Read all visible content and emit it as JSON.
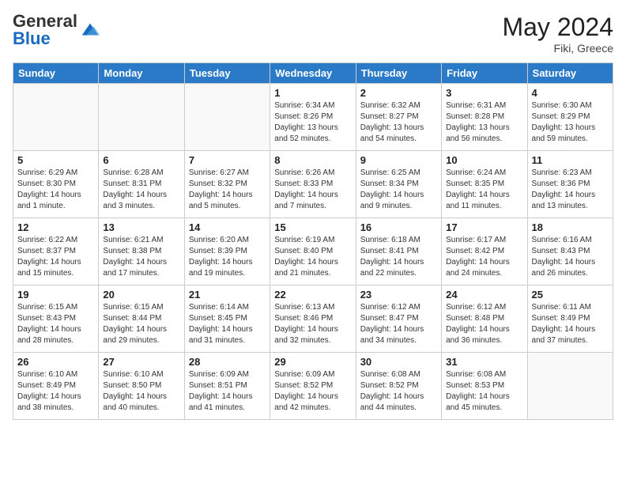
{
  "header": {
    "logo_general": "General",
    "logo_blue": "Blue",
    "month_year": "May 2024",
    "location": "Fiki, Greece"
  },
  "days_of_week": [
    "Sunday",
    "Monday",
    "Tuesday",
    "Wednesday",
    "Thursday",
    "Friday",
    "Saturday"
  ],
  "weeks": [
    [
      {
        "day": "",
        "sunrise": "",
        "sunset": "",
        "daylight": ""
      },
      {
        "day": "",
        "sunrise": "",
        "sunset": "",
        "daylight": ""
      },
      {
        "day": "",
        "sunrise": "",
        "sunset": "",
        "daylight": ""
      },
      {
        "day": "1",
        "sunrise": "Sunrise: 6:34 AM",
        "sunset": "Sunset: 8:26 PM",
        "daylight": "Daylight: 13 hours and 52 minutes."
      },
      {
        "day": "2",
        "sunrise": "Sunrise: 6:32 AM",
        "sunset": "Sunset: 8:27 PM",
        "daylight": "Daylight: 13 hours and 54 minutes."
      },
      {
        "day": "3",
        "sunrise": "Sunrise: 6:31 AM",
        "sunset": "Sunset: 8:28 PM",
        "daylight": "Daylight: 13 hours and 56 minutes."
      },
      {
        "day": "4",
        "sunrise": "Sunrise: 6:30 AM",
        "sunset": "Sunset: 8:29 PM",
        "daylight": "Daylight: 13 hours and 59 minutes."
      }
    ],
    [
      {
        "day": "5",
        "sunrise": "Sunrise: 6:29 AM",
        "sunset": "Sunset: 8:30 PM",
        "daylight": "Daylight: 14 hours and 1 minute."
      },
      {
        "day": "6",
        "sunrise": "Sunrise: 6:28 AM",
        "sunset": "Sunset: 8:31 PM",
        "daylight": "Daylight: 14 hours and 3 minutes."
      },
      {
        "day": "7",
        "sunrise": "Sunrise: 6:27 AM",
        "sunset": "Sunset: 8:32 PM",
        "daylight": "Daylight: 14 hours and 5 minutes."
      },
      {
        "day": "8",
        "sunrise": "Sunrise: 6:26 AM",
        "sunset": "Sunset: 8:33 PM",
        "daylight": "Daylight: 14 hours and 7 minutes."
      },
      {
        "day": "9",
        "sunrise": "Sunrise: 6:25 AM",
        "sunset": "Sunset: 8:34 PM",
        "daylight": "Daylight: 14 hours and 9 minutes."
      },
      {
        "day": "10",
        "sunrise": "Sunrise: 6:24 AM",
        "sunset": "Sunset: 8:35 PM",
        "daylight": "Daylight: 14 hours and 11 minutes."
      },
      {
        "day": "11",
        "sunrise": "Sunrise: 6:23 AM",
        "sunset": "Sunset: 8:36 PM",
        "daylight": "Daylight: 14 hours and 13 minutes."
      }
    ],
    [
      {
        "day": "12",
        "sunrise": "Sunrise: 6:22 AM",
        "sunset": "Sunset: 8:37 PM",
        "daylight": "Daylight: 14 hours and 15 minutes."
      },
      {
        "day": "13",
        "sunrise": "Sunrise: 6:21 AM",
        "sunset": "Sunset: 8:38 PM",
        "daylight": "Daylight: 14 hours and 17 minutes."
      },
      {
        "day": "14",
        "sunrise": "Sunrise: 6:20 AM",
        "sunset": "Sunset: 8:39 PM",
        "daylight": "Daylight: 14 hours and 19 minutes."
      },
      {
        "day": "15",
        "sunrise": "Sunrise: 6:19 AM",
        "sunset": "Sunset: 8:40 PM",
        "daylight": "Daylight: 14 hours and 21 minutes."
      },
      {
        "day": "16",
        "sunrise": "Sunrise: 6:18 AM",
        "sunset": "Sunset: 8:41 PM",
        "daylight": "Daylight: 14 hours and 22 minutes."
      },
      {
        "day": "17",
        "sunrise": "Sunrise: 6:17 AM",
        "sunset": "Sunset: 8:42 PM",
        "daylight": "Daylight: 14 hours and 24 minutes."
      },
      {
        "day": "18",
        "sunrise": "Sunrise: 6:16 AM",
        "sunset": "Sunset: 8:43 PM",
        "daylight": "Daylight: 14 hours and 26 minutes."
      }
    ],
    [
      {
        "day": "19",
        "sunrise": "Sunrise: 6:15 AM",
        "sunset": "Sunset: 8:43 PM",
        "daylight": "Daylight: 14 hours and 28 minutes."
      },
      {
        "day": "20",
        "sunrise": "Sunrise: 6:15 AM",
        "sunset": "Sunset: 8:44 PM",
        "daylight": "Daylight: 14 hours and 29 minutes."
      },
      {
        "day": "21",
        "sunrise": "Sunrise: 6:14 AM",
        "sunset": "Sunset: 8:45 PM",
        "daylight": "Daylight: 14 hours and 31 minutes."
      },
      {
        "day": "22",
        "sunrise": "Sunrise: 6:13 AM",
        "sunset": "Sunset: 8:46 PM",
        "daylight": "Daylight: 14 hours and 32 minutes."
      },
      {
        "day": "23",
        "sunrise": "Sunrise: 6:12 AM",
        "sunset": "Sunset: 8:47 PM",
        "daylight": "Daylight: 14 hours and 34 minutes."
      },
      {
        "day": "24",
        "sunrise": "Sunrise: 6:12 AM",
        "sunset": "Sunset: 8:48 PM",
        "daylight": "Daylight: 14 hours and 36 minutes."
      },
      {
        "day": "25",
        "sunrise": "Sunrise: 6:11 AM",
        "sunset": "Sunset: 8:49 PM",
        "daylight": "Daylight: 14 hours and 37 minutes."
      }
    ],
    [
      {
        "day": "26",
        "sunrise": "Sunrise: 6:10 AM",
        "sunset": "Sunset: 8:49 PM",
        "daylight": "Daylight: 14 hours and 38 minutes."
      },
      {
        "day": "27",
        "sunrise": "Sunrise: 6:10 AM",
        "sunset": "Sunset: 8:50 PM",
        "daylight": "Daylight: 14 hours and 40 minutes."
      },
      {
        "day": "28",
        "sunrise": "Sunrise: 6:09 AM",
        "sunset": "Sunset: 8:51 PM",
        "daylight": "Daylight: 14 hours and 41 minutes."
      },
      {
        "day": "29",
        "sunrise": "Sunrise: 6:09 AM",
        "sunset": "Sunset: 8:52 PM",
        "daylight": "Daylight: 14 hours and 42 minutes."
      },
      {
        "day": "30",
        "sunrise": "Sunrise: 6:08 AM",
        "sunset": "Sunset: 8:52 PM",
        "daylight": "Daylight: 14 hours and 44 minutes."
      },
      {
        "day": "31",
        "sunrise": "Sunrise: 6:08 AM",
        "sunset": "Sunset: 8:53 PM",
        "daylight": "Daylight: 14 hours and 45 minutes."
      },
      {
        "day": "",
        "sunrise": "",
        "sunset": "",
        "daylight": ""
      }
    ]
  ]
}
